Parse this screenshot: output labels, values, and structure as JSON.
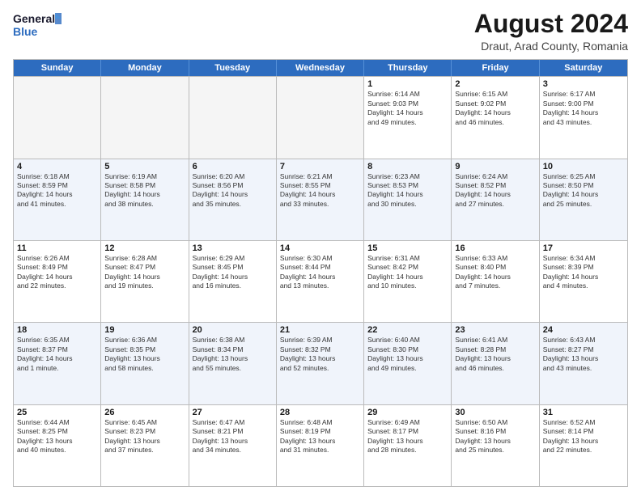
{
  "header": {
    "logo_line1": "General",
    "logo_line2": "Blue",
    "main_title": "August 2024",
    "sub_title": "Draut, Arad County, Romania"
  },
  "days_of_week": [
    "Sunday",
    "Monday",
    "Tuesday",
    "Wednesday",
    "Thursday",
    "Friday",
    "Saturday"
  ],
  "rows": [
    [
      {
        "day": "",
        "info": "",
        "empty": true
      },
      {
        "day": "",
        "info": "",
        "empty": true
      },
      {
        "day": "",
        "info": "",
        "empty": true
      },
      {
        "day": "",
        "info": "",
        "empty": true
      },
      {
        "day": "1",
        "info": "Sunrise: 6:14 AM\nSunset: 9:03 PM\nDaylight: 14 hours\nand 49 minutes."
      },
      {
        "day": "2",
        "info": "Sunrise: 6:15 AM\nSunset: 9:02 PM\nDaylight: 14 hours\nand 46 minutes."
      },
      {
        "day": "3",
        "info": "Sunrise: 6:17 AM\nSunset: 9:00 PM\nDaylight: 14 hours\nand 43 minutes."
      }
    ],
    [
      {
        "day": "4",
        "info": "Sunrise: 6:18 AM\nSunset: 8:59 PM\nDaylight: 14 hours\nand 41 minutes."
      },
      {
        "day": "5",
        "info": "Sunrise: 6:19 AM\nSunset: 8:58 PM\nDaylight: 14 hours\nand 38 minutes."
      },
      {
        "day": "6",
        "info": "Sunrise: 6:20 AM\nSunset: 8:56 PM\nDaylight: 14 hours\nand 35 minutes."
      },
      {
        "day": "7",
        "info": "Sunrise: 6:21 AM\nSunset: 8:55 PM\nDaylight: 14 hours\nand 33 minutes."
      },
      {
        "day": "8",
        "info": "Sunrise: 6:23 AM\nSunset: 8:53 PM\nDaylight: 14 hours\nand 30 minutes."
      },
      {
        "day": "9",
        "info": "Sunrise: 6:24 AM\nSunset: 8:52 PM\nDaylight: 14 hours\nand 27 minutes."
      },
      {
        "day": "10",
        "info": "Sunrise: 6:25 AM\nSunset: 8:50 PM\nDaylight: 14 hours\nand 25 minutes."
      }
    ],
    [
      {
        "day": "11",
        "info": "Sunrise: 6:26 AM\nSunset: 8:49 PM\nDaylight: 14 hours\nand 22 minutes."
      },
      {
        "day": "12",
        "info": "Sunrise: 6:28 AM\nSunset: 8:47 PM\nDaylight: 14 hours\nand 19 minutes."
      },
      {
        "day": "13",
        "info": "Sunrise: 6:29 AM\nSunset: 8:45 PM\nDaylight: 14 hours\nand 16 minutes."
      },
      {
        "day": "14",
        "info": "Sunrise: 6:30 AM\nSunset: 8:44 PM\nDaylight: 14 hours\nand 13 minutes."
      },
      {
        "day": "15",
        "info": "Sunrise: 6:31 AM\nSunset: 8:42 PM\nDaylight: 14 hours\nand 10 minutes."
      },
      {
        "day": "16",
        "info": "Sunrise: 6:33 AM\nSunset: 8:40 PM\nDaylight: 14 hours\nand 7 minutes."
      },
      {
        "day": "17",
        "info": "Sunrise: 6:34 AM\nSunset: 8:39 PM\nDaylight: 14 hours\nand 4 minutes."
      }
    ],
    [
      {
        "day": "18",
        "info": "Sunrise: 6:35 AM\nSunset: 8:37 PM\nDaylight: 14 hours\nand 1 minute."
      },
      {
        "day": "19",
        "info": "Sunrise: 6:36 AM\nSunset: 8:35 PM\nDaylight: 13 hours\nand 58 minutes."
      },
      {
        "day": "20",
        "info": "Sunrise: 6:38 AM\nSunset: 8:34 PM\nDaylight: 13 hours\nand 55 minutes."
      },
      {
        "day": "21",
        "info": "Sunrise: 6:39 AM\nSunset: 8:32 PM\nDaylight: 13 hours\nand 52 minutes."
      },
      {
        "day": "22",
        "info": "Sunrise: 6:40 AM\nSunset: 8:30 PM\nDaylight: 13 hours\nand 49 minutes."
      },
      {
        "day": "23",
        "info": "Sunrise: 6:41 AM\nSunset: 8:28 PM\nDaylight: 13 hours\nand 46 minutes."
      },
      {
        "day": "24",
        "info": "Sunrise: 6:43 AM\nSunset: 8:27 PM\nDaylight: 13 hours\nand 43 minutes."
      }
    ],
    [
      {
        "day": "25",
        "info": "Sunrise: 6:44 AM\nSunset: 8:25 PM\nDaylight: 13 hours\nand 40 minutes."
      },
      {
        "day": "26",
        "info": "Sunrise: 6:45 AM\nSunset: 8:23 PM\nDaylight: 13 hours\nand 37 minutes."
      },
      {
        "day": "27",
        "info": "Sunrise: 6:47 AM\nSunset: 8:21 PM\nDaylight: 13 hours\nand 34 minutes."
      },
      {
        "day": "28",
        "info": "Sunrise: 6:48 AM\nSunset: 8:19 PM\nDaylight: 13 hours\nand 31 minutes."
      },
      {
        "day": "29",
        "info": "Sunrise: 6:49 AM\nSunset: 8:17 PM\nDaylight: 13 hours\nand 28 minutes."
      },
      {
        "day": "30",
        "info": "Sunrise: 6:50 AM\nSunset: 8:16 PM\nDaylight: 13 hours\nand 25 minutes."
      },
      {
        "day": "31",
        "info": "Sunrise: 6:52 AM\nSunset: 8:14 PM\nDaylight: 13 hours\nand 22 minutes."
      }
    ]
  ]
}
